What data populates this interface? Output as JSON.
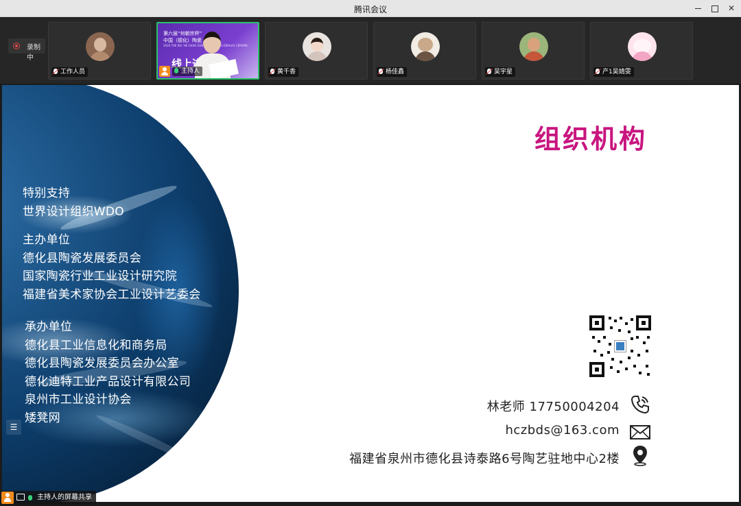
{
  "window": {
    "title": "腾讯会议"
  },
  "recording": {
    "label": "录制中"
  },
  "participants": [
    {
      "name": "工作人员",
      "mic": "muted",
      "avatar_colors": [
        "#d6b9a0",
        "#8a6650"
      ]
    },
    {
      "name": "主持人",
      "mic": "on",
      "host": true,
      "video_text": [
        "第六届“何朝宗杯”",
        "中国（德化）陶瓷",
        "2020 THE 6th 'HE CHAO ZONG CUP' CHINA (DEHUA) CERAMIC",
        "线上进"
      ]
    },
    {
      "name": "黄千香",
      "mic": "muted",
      "avatar_colors": [
        "#f3d7c8",
        "#e9e4df"
      ]
    },
    {
      "name": "杨佳鑫",
      "mic": "muted",
      "avatar_colors": [
        "#c9a98a",
        "#f2ece4"
      ]
    },
    {
      "name": "吴宇星",
      "mic": "muted",
      "avatar_colors": [
        "#d9a27c",
        "#9bb57a"
      ]
    },
    {
      "name": "产1吴婧雯",
      "mic": "muted",
      "avatar_colors": [
        "#ffe4ee",
        "#f3a6c4"
      ]
    }
  ],
  "slide": {
    "heading": "组织机构",
    "sections": [
      {
        "lines": [
          "特别支持",
          "世界设计组织WDO"
        ]
      },
      {
        "lines": [
          "主办单位",
          "德化县陶瓷发展委员会",
          "国家陶瓷行业工业设计研究院",
          "福建省美术家协会工业设计艺委会"
        ]
      },
      {
        "lines": [
          "承办单位",
          "德化县工业信息化和商务局",
          "德化县陶瓷发展委员会办公室",
          "德化迪特工业产品设计有限公司",
          "泉州市工业设计协会",
          "矮凳网"
        ]
      }
    ],
    "contacts": {
      "phone": "林老师 17750004204",
      "email": "hczbds@163.com",
      "address": "福建省泉州市德化县诗泰路6号陶艺驻地中心2楼"
    },
    "colors": {
      "heading": "#c8157f",
      "planet": "#0d3d6b"
    }
  },
  "share_bar": {
    "label": "主持人的屏幕共享"
  }
}
